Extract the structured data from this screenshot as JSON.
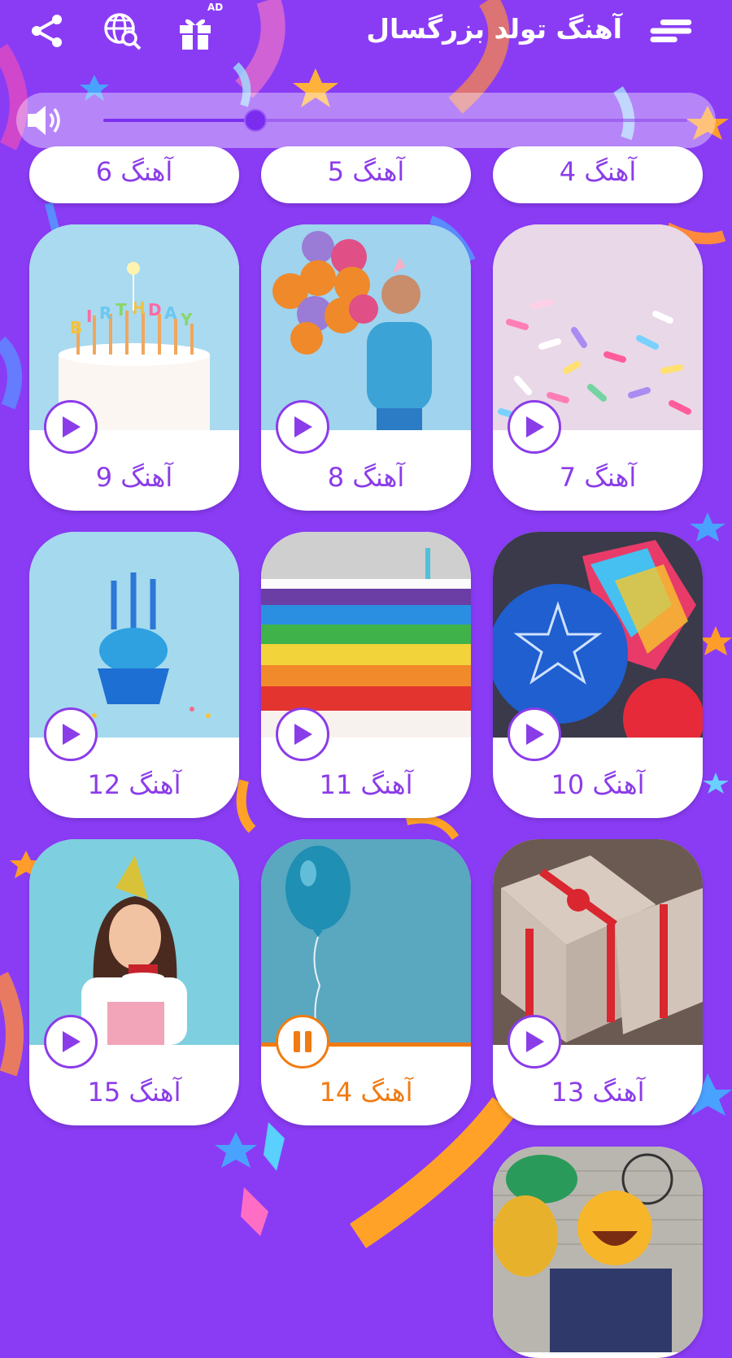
{
  "header": {
    "title": "آهنگ تولد بزرگسال",
    "ad_badge": "AD",
    "icons": [
      "menu-icon",
      "gift-ad-icon",
      "web-search-icon",
      "share-icon"
    ]
  },
  "volume": {
    "level": 0.26,
    "icon": "speaker-icon"
  },
  "colors": {
    "background": "#8a3cf5",
    "accent": "#8b3ce9",
    "active": "#f07b12"
  },
  "songs_partial": [
    {
      "label": "آهنگ 4"
    },
    {
      "label": "آهنگ 5"
    },
    {
      "label": "آهنگ 6"
    }
  ],
  "songs": [
    {
      "label": "آهنگ 7",
      "image": "sprinkles-image",
      "state": "play"
    },
    {
      "label": "آهنگ 8",
      "image": "man-with-balloons-image",
      "state": "play"
    },
    {
      "label": "آهنگ 9",
      "image": "birthday-cake-image",
      "state": "play"
    },
    {
      "label": "آهنگ 10",
      "image": "happy-birthday-balloons-image",
      "state": "play"
    },
    {
      "label": "آهنگ 11",
      "image": "rainbow-cake-image",
      "state": "play"
    },
    {
      "label": "آهنگ 12",
      "image": "cupcake-image",
      "state": "play"
    },
    {
      "label": "آهنگ 13",
      "image": "gift-boxes-image",
      "state": "play"
    },
    {
      "label": "آهنگ 14",
      "image": "blue-balloon-image",
      "state": "pause",
      "progress": 1.0
    },
    {
      "label": "آهنگ 15",
      "image": "girl-with-cake-image",
      "state": "play"
    }
  ],
  "songs_bottom": [
    {
      "image": "emoji-balloon-image"
    }
  ]
}
